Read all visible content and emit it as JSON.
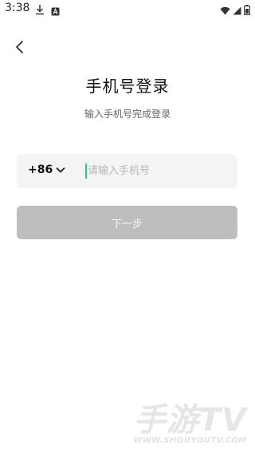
{
  "status_bar": {
    "time": "3:38",
    "icons": [
      "download-icon",
      "a-notification-icon",
      "wifi-icon",
      "signal-icon",
      "battery-icon"
    ]
  },
  "header": {
    "back_icon": "chevron-left-icon",
    "title": "手机号登录",
    "subtitle": "输入手机号完成登录"
  },
  "form": {
    "country_code": "+86",
    "phone_placeholder": "请输入手机号",
    "phone_value": "",
    "next_label": "下一步"
  },
  "watermark": {
    "logo": "手游TV",
    "url": "WWW.SHOUYOUTV.COM"
  },
  "colors": {
    "accent_caret": "#2cc3a0",
    "button_disabled": "#bdbdbd",
    "input_bg": "#f4f4f4"
  }
}
